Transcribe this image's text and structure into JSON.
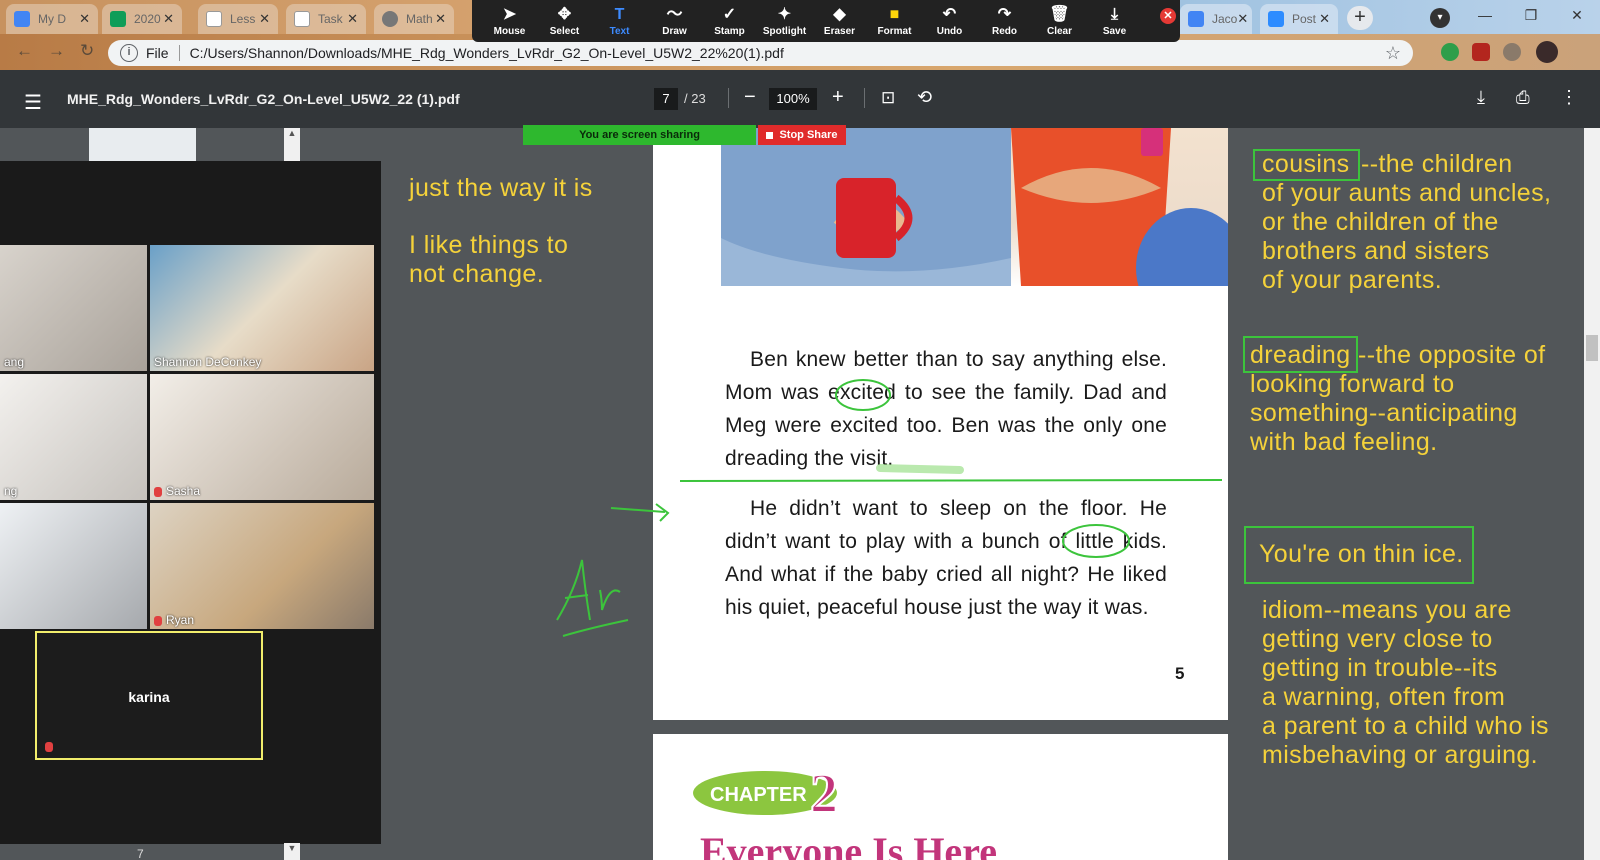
{
  "browser": {
    "tabs": [
      {
        "label": "My D",
        "color": "#4285f4"
      },
      {
        "label": "2020",
        "color": "#0f9d58"
      },
      {
        "label": "Less",
        "color": "#ffffff"
      },
      {
        "label": "Task",
        "color": "#ffffff"
      },
      {
        "label": "Math",
        "color": "#777777"
      },
      {
        "label": "Jaco",
        "color": "#4285f4"
      },
      {
        "label": "Post",
        "color": "#2d8cff"
      }
    ],
    "url_prefix": "File",
    "url": "C:/Users/Shannon/Downloads/MHE_Rdg_Wonders_LvRdr_G2_On-Level_U5W2_22%20(1).pdf"
  },
  "annotation_tools": [
    {
      "label": "Mouse",
      "icon": "cursor-icon",
      "glyph": "➤"
    },
    {
      "label": "Select",
      "icon": "move-icon",
      "glyph": "✥"
    },
    {
      "label": "Text",
      "icon": "text-icon",
      "glyph": "T"
    },
    {
      "label": "Draw",
      "icon": "draw-icon",
      "glyph": "〜"
    },
    {
      "label": "Stamp",
      "icon": "stamp-icon",
      "glyph": "✓"
    },
    {
      "label": "Spotlight",
      "icon": "spotlight-icon",
      "glyph": "✦"
    },
    {
      "label": "Eraser",
      "icon": "eraser-icon",
      "glyph": "◆"
    },
    {
      "label": "Format",
      "icon": "format-icon",
      "glyph": "■"
    },
    {
      "label": "Undo",
      "icon": "undo-icon",
      "glyph": "↶"
    },
    {
      "label": "Redo",
      "icon": "redo-icon",
      "glyph": "↷"
    },
    {
      "label": "Clear",
      "icon": "trash-icon",
      "glyph": "🗑"
    },
    {
      "label": "Save",
      "icon": "save-icon",
      "glyph": "⤓"
    }
  ],
  "pdf": {
    "filename": "MHE_Rdg_Wonders_LvRdr_G2_On-Level_U5W2_22 (1).pdf",
    "page": "7",
    "total": "/ 23",
    "zoom": "100%"
  },
  "share": {
    "banner": "You are screen sharing",
    "stop": "Stop Share"
  },
  "participants": [
    {
      "name": "ang"
    },
    {
      "name": "Shannon DeConkey"
    },
    {
      "name": "ng"
    },
    {
      "name": "Sasha"
    },
    {
      "name": ""
    },
    {
      "name": "Ryan"
    },
    {
      "name": "karina"
    }
  ],
  "sidebar_page": "7",
  "story": {
    "para1": "Ben knew better than to say anything else. Mom was excited to see the family. Dad and Meg were excited too. Ben was the only one dreading the visit.",
    "para2": "He didn’t want to sleep on the floor. He didn’t want to play with a bunch of little kids. And what if the baby cried all night? He liked his quiet, peaceful house just the way it was.",
    "page_number": "5",
    "chapter_label": "CHAPTER",
    "chapter_num": "2",
    "chapter_title": "Everyone Is Here"
  },
  "notes_left": {
    "line1": "just the way it is",
    "line2a": "I like things to",
    "line2b": "not change.",
    "handwriting": "Ar"
  },
  "notes_right": {
    "cousins_word": "cousins",
    "cousins_def": [
      "--the children",
      "of your aunts and uncles,",
      "or the children of the",
      "brothers and sisters",
      "of your parents."
    ],
    "dreading_word": "dreading",
    "dreading_def": [
      "--the opposite of",
      "looking forward to",
      "something--anticipating",
      "with bad feeling."
    ],
    "idiom": "You're on thin ice.",
    "idiom_def": [
      "idiom--means you are",
      "getting very close to",
      "getting in trouble--its",
      "a warning, often from",
      "a parent to a child who is",
      "misbehaving or arguing."
    ]
  },
  "colors": {
    "annotation_yellow": "#f5d23a",
    "annotation_green": "#3cc43c",
    "share_green": "#2eb82e",
    "stop_red": "#e02b2b"
  }
}
